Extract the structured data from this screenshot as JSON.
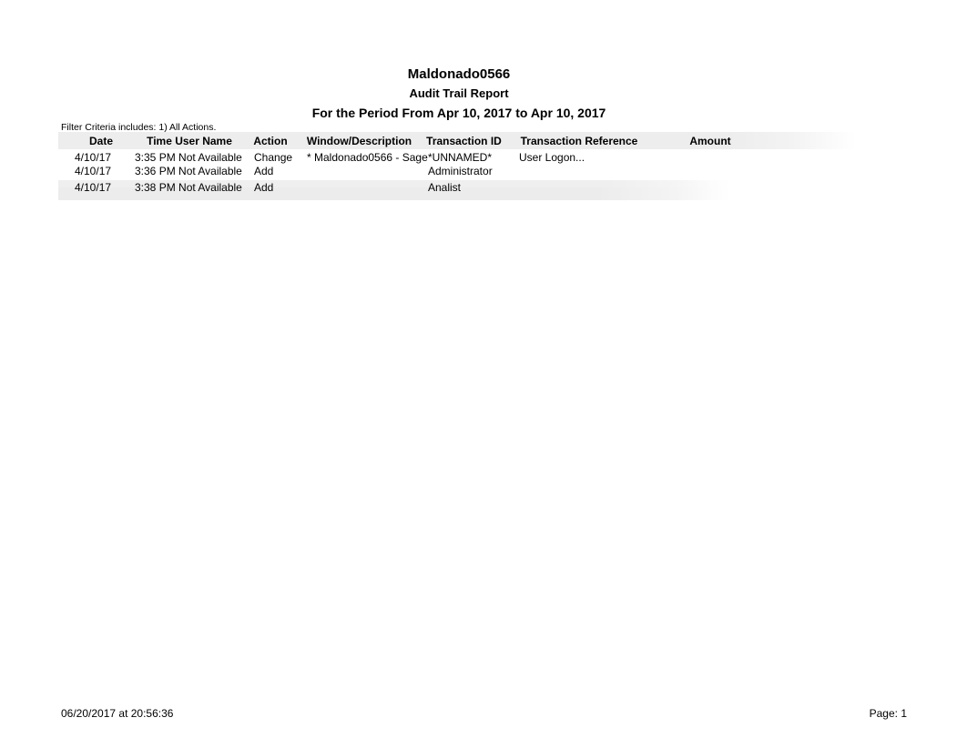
{
  "report": {
    "company": "Maldonado0566",
    "title": "Audit Trail Report",
    "period": "For the Period From Apr 10, 2017 to Apr 10, 2017",
    "filter_criteria": "Filter Criteria includes: 1) All Actions."
  },
  "table": {
    "headers": {
      "date": "Date",
      "time_user_name": "Time User Name",
      "action": "Action",
      "window_description": "Window/Description",
      "transaction_id": "Transaction ID",
      "transaction_reference": "Transaction Reference",
      "amount": "Amount"
    },
    "rows": [
      {
        "date": "4/10/17",
        "time_user_name": "3:35 PM Not Available",
        "action": "Change",
        "window_description": "* Maldonado0566 - Sage",
        "transaction_id": "*UNNAMED*",
        "transaction_reference": "User Logon...",
        "amount": ""
      },
      {
        "date": "4/10/17",
        "time_user_name": "3:36 PM Not Available",
        "action": "Add",
        "window_description": "",
        "transaction_id": "Administrator",
        "transaction_reference": "",
        "amount": ""
      },
      {
        "date": "4/10/17",
        "time_user_name": "3:38 PM Not Available",
        "action": "Add",
        "window_description": "",
        "transaction_id": "Analist",
        "transaction_reference": "",
        "amount": ""
      }
    ]
  },
  "footer": {
    "generated": "06/20/2017 at 20:56:36",
    "page": "Page: 1"
  },
  "colors": {
    "text": "#000000",
    "band": "#ededed",
    "page_background": "#ffffff"
  }
}
